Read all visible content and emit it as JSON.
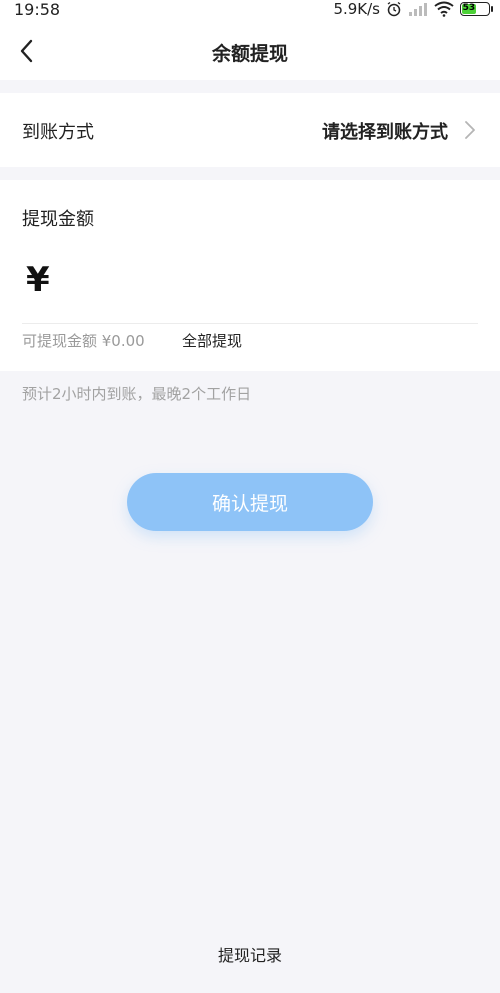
{
  "status_bar": {
    "time": "19:58",
    "net_speed": "5.9K/s",
    "battery_level": "53",
    "battery_color": "#4cd137"
  },
  "header": {
    "title": "余额提现",
    "back_icon": "chevron-left-icon"
  },
  "method": {
    "label": "到账方式",
    "value": "请选择到账方式",
    "chevron_icon": "chevron-right-icon"
  },
  "amount": {
    "label": "提现金额",
    "currency_symbol": "¥",
    "input_value": "",
    "available_label": "可提现金额 ¥0.00",
    "withdraw_all_label": "全部提现"
  },
  "note": "预计2小时内到账，最晚2个工作日",
  "confirm_button": {
    "label": "确认提现",
    "color": "#8ec3f7"
  },
  "footer": {
    "records_link": "提现记录"
  }
}
